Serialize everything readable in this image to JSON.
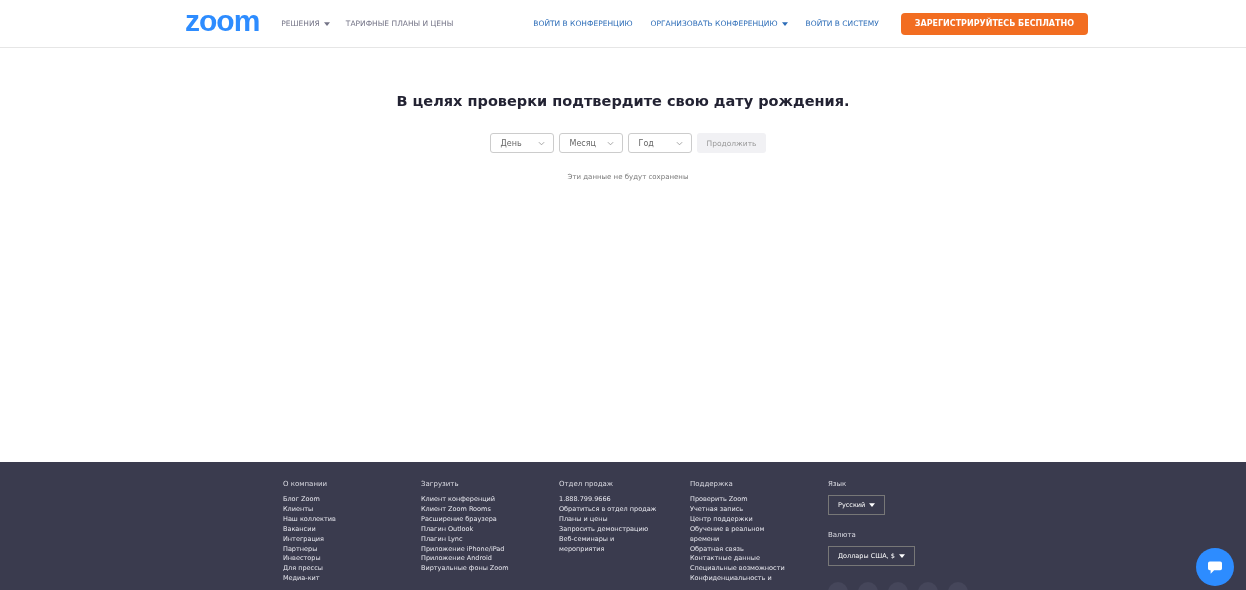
{
  "header": {
    "logo": "zoom",
    "nav_left": [
      {
        "label": "РЕШЕНИЯ",
        "dropdown": true
      },
      {
        "label": "ТАРИФНЫЕ ПЛАНЫ И ЦЕНЫ",
        "dropdown": false
      }
    ],
    "nav_right": [
      {
        "label": "ВОЙТИ В КОНФЕРЕНЦИЮ",
        "dropdown": false
      },
      {
        "label": "ОРГАНИЗОВАТЬ КОНФЕРЕНЦИЮ",
        "dropdown": true
      },
      {
        "label": "ВОЙТИ В СИСТЕМУ",
        "dropdown": false
      }
    ],
    "signup_button": "ЗАРЕГИСТРИРУЙТЕСЬ БЕСПЛАТНО"
  },
  "form": {
    "title": "В целях проверки подтвердите свою дату рождения.",
    "selects": [
      {
        "placeholder": "День"
      },
      {
        "placeholder": "Месяц"
      },
      {
        "placeholder": "Год"
      }
    ],
    "continue_button": {
      "label": "Продолжить",
      "disabled": true
    },
    "note": "Эти данные не будут сохранены"
  },
  "footer": {
    "columns": [
      {
        "heading": "О компании",
        "items": [
          "Блог Zoom",
          "Клиенты",
          "Наш коллектив",
          "Вакансии",
          "Интеграция",
          "Партнеры",
          "Инвесторы",
          "Для прессы",
          "Медиа-кит"
        ]
      },
      {
        "heading": "Загрузить",
        "items": [
          "Клиент конференций",
          "Клиент Zoom Rooms",
          "Расширение браузера",
          "Плагин Outlook",
          "Плагин Lync",
          "Приложение iPhone/iPad",
          "Приложение Android",
          "Виртуальные фоны Zoom"
        ]
      },
      {
        "heading": "Отдел продаж",
        "items": [
          "1.888.799.9666",
          "Обратиться в отдел продаж",
          "Планы и цены",
          "Запросить демонстрацию",
          "Веб-семинары и",
          "мероприятия"
        ]
      },
      {
        "heading": "Поддержка",
        "items": [
          "Проверить Zoom",
          "Учетная запись",
          "Центр поддержки",
          "Обучение в реальном",
          "времени",
          "Обратная связь",
          "Контактные данные",
          "Специальные возможности",
          "Конфиденциальность и"
        ]
      }
    ],
    "language": {
      "label": "Язык",
      "value": "Русский"
    },
    "currency": {
      "label": "Валюта",
      "value": "Доллары США, $"
    }
  }
}
